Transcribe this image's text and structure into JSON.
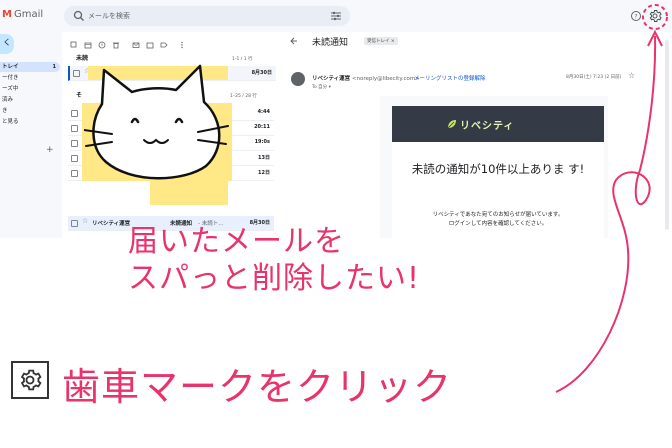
{
  "app": {
    "name": "Gmail"
  },
  "search": {
    "placeholder": "メールを検索"
  },
  "sidebar": {
    "compose": "く",
    "items": [
      {
        "label": "トレイ",
        "count": "1",
        "active": true
      },
      {
        "label": "ー付き"
      },
      {
        "label": "ーズ中"
      },
      {
        "label": "済み"
      },
      {
        "label": "き"
      },
      {
        "label": "と見る"
      }
    ]
  },
  "list": {
    "sections": [
      {
        "title": "未読",
        "count": "1-1 / 1 行"
      },
      {
        "title": "そ",
        "count": "1–25 / 28 行"
      }
    ],
    "unread_row": {
      "date": "8月30日"
    },
    "other_dates": [
      "4:44",
      "20:11",
      "19:0s",
      "13日",
      "12日"
    ],
    "bottom_row": {
      "sender": "リベシティ運営",
      "subject": "未読通知",
      "snippet": "- 未読ト...",
      "date": "8月30日"
    }
  },
  "message": {
    "subject": "未読通知",
    "label": "受信トレイ ×",
    "from_name": "リベシティ運営",
    "from_email": "<noreply@libecity.com>",
    "unsubscribe": "メーリングリストの登録解除",
    "to": "To 自分 ▾",
    "date": "8月30日(土) 7:23 (2 日前)",
    "brand": "リベシティ",
    "title": "未読の通知が10件以上ありま す!",
    "line1": "リベシティであなた宛てのお知らせが届いています。",
    "line2": "ログインして内容を確認してください。"
  },
  "annotation": {
    "caption1": "届いたメールを",
    "caption2": "スパっと削除したい!",
    "caption3": "歯車マークをクリック",
    "color": "#e8336b"
  },
  "icons": [
    "search-icon",
    "tune-icon",
    "help-icon",
    "gear-icon",
    "settings-gear-icon"
  ]
}
